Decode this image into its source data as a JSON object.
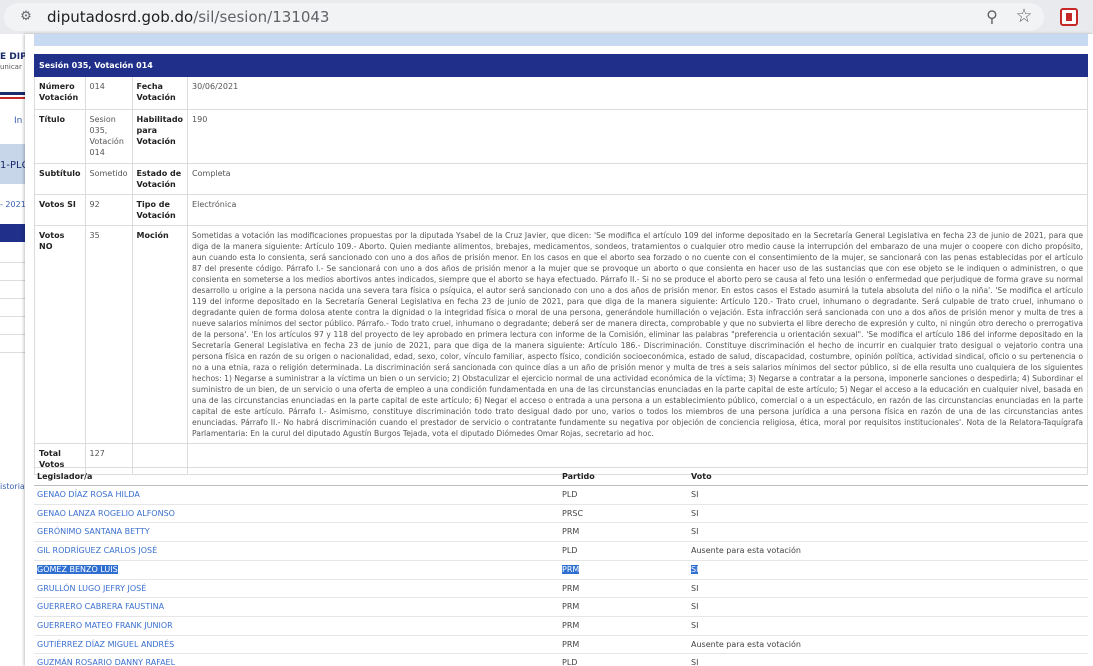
{
  "browser": {
    "url_host": "diputadosrd.gob.do",
    "url_path": "/sil/sesion/131043"
  },
  "background": {
    "logo_line1": "E DIP",
    "logo_line2": "unicar",
    "link1": "In",
    "tab_text": "1-PLC",
    "date_text": "- 2021 -",
    "history_text": "istorial"
  },
  "detail": {
    "header": "Sesión 035, Votación 014",
    "labels": {
      "numero": "Número Votación",
      "fecha": "Fecha Votación",
      "titulo": "Título",
      "habilitado": "Habilitado para Votación",
      "subtitulo": "Subtítulo",
      "estado": "Estado de Votación",
      "votos_si": "Votos SI",
      "tipo": "Tipo de Votación",
      "votos_no": "Votos NO",
      "mocion": "Moción",
      "total": "Total Votos"
    },
    "values": {
      "numero": "014",
      "fecha": "30/06/2021",
      "titulo": "Sesion 035, Votación 014",
      "habilitado": "190",
      "subtitulo": "Sometido",
      "estado": "Completa",
      "votos_si": "92",
      "tipo": "Electrónica",
      "votos_no": "35",
      "total": "127",
      "mocion": "Sometidas a votación las modificaciones propuestas por la diputada Ysabel de la Cruz Javier, que dicen: 'Se modifica el artículo 109 del informe depositado en la Secretaría General Legislativa en fecha 23 de junio de 2021, para que diga de la manera siguiente: Artículo 109.- Aborto. Quien mediante alimentos, brebajes, medicamentos, sondeos, tratamientos o cualquier otro medio cause la interrupción del embarazo de una mujer o coopere con dicho propósito, aun cuando esta lo consienta, será sancionado con uno a dos años de prisión menor. En los casos en que el aborto sea forzado o no cuente con el consentimiento de la mujer, se sancionará con las penas establecidas por el artículo 87 del presente código. Párrafo I.- Se sancionará con uno a dos años de prisión menor a la mujer que se provoque un aborto o que consienta en hacer uso de las sustancias que con ese objeto se le indiquen o administren, o que consienta en someterse a los medios abortivos antes indicados, siempre que el aborto se haya efectuado. Párrafo II.- Si no se produce el aborto pero se causa al feto una lesión o enfermedad que perjudique de forma grave su normal desarrollo u origine a la persona nacida una severa tara física o psíquica, el autor será sancionado con uno a dos años de prisión menor. En estos casos el Estado asumirá la tutela absoluta del niño o la niña'. 'Se modifica el artículo 119 del informe depositado en la Secretaría General Legislativa en fecha 23 de junio de 2021, para que diga de la manera siguiente: Artículo 120.- Trato cruel, inhumano o degradante. Será culpable de trato cruel, inhumano o degradante quien de forma dolosa atente contra la dignidad o la integridad física o moral de una persona, generándole humillación o vejación. Esta infracción será sancionada con uno a dos años de prisión menor y multa de tres a nueve salarios mínimos del sector público. Párrafo.- Todo trato cruel, inhumano o degradante; deberá ser de manera directa, comprobable y que no subvierta el libre derecho de expresión y culto, ni ningún otro derecho o prerrogativa de la persona'. 'En los artículos 97 y 118 del proyecto de ley aprobado en primera lectura con informe de la Comisión, eliminar las palabras \"preferencia u orientación sexual\". 'Se modifica el artículo 186 del informe depositado en la Secretaría General Legislativa en fecha 23 de junio de 2021, para que diga de la manera siguiente: Artículo 186.- Discriminación. Constituye discriminación el hecho de incurrir en cualquier trato desigual o vejatorio contra una persona física en razón de su origen o nacionalidad, edad, sexo, color, vínculo familiar, aspecto físico, condición socioeconómica, estado de salud, discapacidad, costumbre, opinión política, actividad sindical, oficio o su pertenencia o no a una etnia, raza o religión determinada. La discriminación será sancionada con quince días a un año de prisión menor y multa de tres a seis salarios mínimos del sector público, si de ella resulta uno cualquiera de los siguientes hechos: 1) Negarse a suministrar a la víctima un bien o un servicio; 2) Obstaculizar el ejercicio normal de una actividad económica de la víctima; 3) Negarse a contratar a la persona, imponerle sanciones o despedirla; 4) Subordinar el suministro de un bien, de un servicio o una oferta de empleo a una condición fundamentada en una de las circunstancias enunciadas en la parte capital de este artículo; 5) Negar el acceso a la educación en cualquier nivel, basada en una de las circunstancias enunciadas en la parte capital de este artículo; 6) Negar el acceso o entrada a una persona a un establecimiento público, comercial o a un espectáculo, en razón de las circunstancias enunciadas en la parte capital de este artículo. Párrafo I.- Asimismo, constituye discriminación todo trato desigual dado por uno, varios o todos los miembros de una persona jurídica a una persona física en razón de una de las circunstancias antes enunciadas. Párrafo II.- No habrá discriminación cuando el prestador de servicio o contratante fundamente su negativa por objeción de conciencia religiosa, ética, moral por requisitos institucionales'. Nota de la Relatora-Taquígrafa Parlamentaria: En la curul del diputado Agustín Burgos Tejada, vota el diputado Diómedes Omar Rojas, secretario ad hoc."
    }
  },
  "legislators": {
    "headers": [
      "Legislador/a",
      "Partido",
      "Voto"
    ],
    "rows": [
      {
        "name": "GENAO DÍAZ ROSA HILDA",
        "party": "PLD",
        "vote": "SI"
      },
      {
        "name": "GENAO LANZA ROGELIO ALFONSO",
        "party": "PRSC",
        "vote": "SI"
      },
      {
        "name": "GERÓNIMO SANTANA BETTY",
        "party": "PRM",
        "vote": "SI"
      },
      {
        "name": "GIL RODRÍGUEZ CARLOS JOSÉ",
        "party": "PLD",
        "vote": "Ausente para esta votación"
      },
      {
        "name": "GÓMEZ BENZO LUIS",
        "party": "PRM",
        "vote": "SI"
      },
      {
        "name": "GRULLÓN LUGO JEFRY JOSÉ",
        "party": "PRM",
        "vote": "SI"
      },
      {
        "name": "GUERRERO CABRERA FAUSTINA",
        "party": "PRM",
        "vote": "SI"
      },
      {
        "name": "GUERRERO MATEO FRANK JUNIOR",
        "party": "PRM",
        "vote": "SI"
      },
      {
        "name": "GUTIÉRREZ DÍAZ MIGUEL ANDRÉS",
        "party": "PRM",
        "vote": "Ausente para esta votación"
      },
      {
        "name": "GUZMÁN ROSARIO DANNY RAFAEL",
        "party": "PLD",
        "vote": "SI"
      }
    ]
  }
}
